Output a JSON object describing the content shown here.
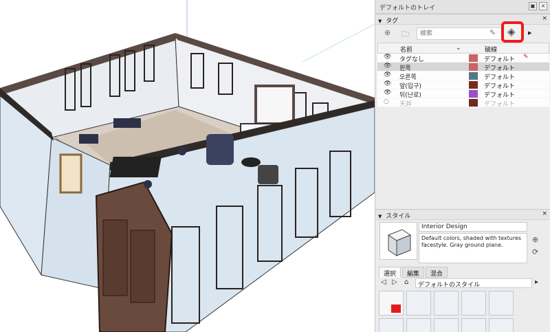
{
  "tray": {
    "title": "デフォルトのトレイ"
  },
  "tags_panel": {
    "title": "タグ",
    "search_placeholder": "検索",
    "columns": {
      "name": "名前",
      "dash": "破線"
    },
    "rows": [
      {
        "name": "タグなし",
        "color": "#c86464",
        "dash": "デフォルト",
        "visible": true,
        "selected": false,
        "editing": true
      },
      {
        "name": "왼쪽",
        "color": "#c86464",
        "dash": "デフォルト",
        "visible": true,
        "selected": true,
        "editing": false
      },
      {
        "name": "오른쪽",
        "color": "#4f7a86",
        "dash": "デフォルト",
        "visible": true,
        "selected": false,
        "editing": false
      },
      {
        "name": "앞(입구)",
        "color": "#7a2a1c",
        "dash": "デフォルト",
        "visible": true,
        "selected": false,
        "editing": false
      },
      {
        "name": "뒤(난로)",
        "color": "#9b4fc9",
        "dash": "デフォルト",
        "visible": true,
        "selected": false,
        "editing": false
      },
      {
        "name": "天井",
        "color": "#6e2a1c",
        "dash": "デフォルト",
        "visible": false,
        "selected": false,
        "editing": false
      }
    ]
  },
  "style_panel": {
    "title": "スタイル",
    "style_name": "Interior Design",
    "description": "Default colors, shaded with textures facestyle. Gray ground plane.",
    "tabs": [
      "選択",
      "編集",
      "混合"
    ],
    "collection": "デフォルトのスタイル"
  },
  "colors": {
    "highlight": "#ee1c1c"
  }
}
